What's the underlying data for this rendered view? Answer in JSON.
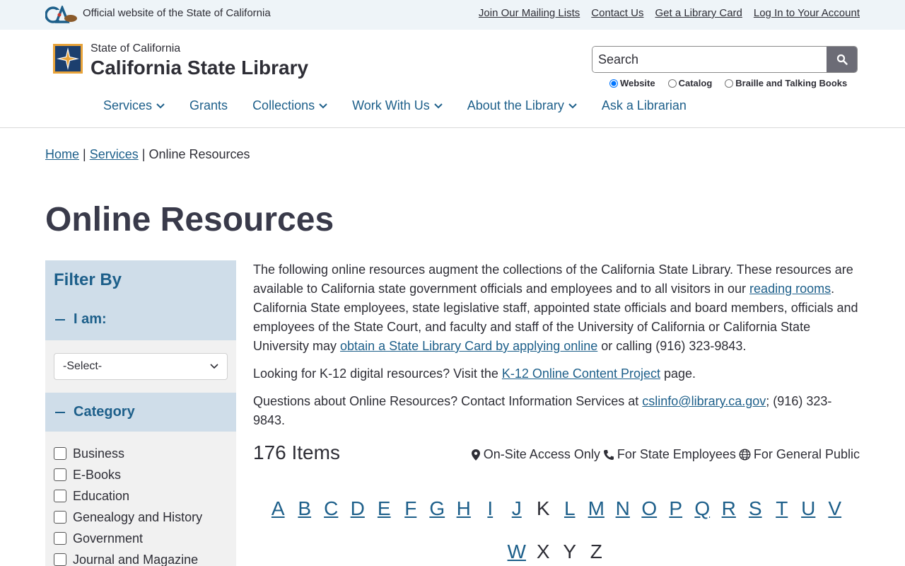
{
  "utility": {
    "official_text": "Official website of the State of California",
    "links": [
      "Join Our Mailing Lists",
      "Contact Us",
      "Get a Library Card",
      "Log In to Your Account"
    ]
  },
  "header": {
    "state_label": "State of California",
    "site_title": "California State Library",
    "search": {
      "placeholder": "Search",
      "scopes": [
        "Website",
        "Catalog",
        "Braille and Talking Books"
      ],
      "selected_scope": "Website"
    },
    "nav": [
      {
        "label": "Services",
        "dropdown": true
      },
      {
        "label": "Grants",
        "dropdown": false
      },
      {
        "label": "Collections",
        "dropdown": true
      },
      {
        "label": "Work With Us",
        "dropdown": true
      },
      {
        "label": "About the Library",
        "dropdown": true
      },
      {
        "label": "Ask a Librarian",
        "dropdown": false
      }
    ]
  },
  "breadcrumb": {
    "home": "Home",
    "services": "Services",
    "current": "Online Resources",
    "sep": "|"
  },
  "page_title": "Online Resources",
  "sidebar": {
    "title": "Filter By",
    "i_am_label": "I am:",
    "select_value": "-Select-",
    "category_label": "Category",
    "categories": [
      "Business",
      "E-Books",
      "Education",
      "Genealogy and History",
      "Government",
      "Journal and Magazine"
    ]
  },
  "content": {
    "p1_a": "The following online resources augment the collections of the California State Library. These resources are available to California state government officials and employees and to all visitors in our ",
    "p1_link1": "reading rooms",
    "p1_b": ". California State employees, state legislative staff, appointed state officials and board members, officials and employees of the State Court, and faculty and staff of the University of California or California State University may ",
    "p1_link2": "obtain a State Library Card by applying online",
    "p1_c": " or calling (916) 323-9843.",
    "p2_a": "Looking for K-12 digital resources? Visit the ",
    "p2_link": "K-12 Online Content Project",
    "p2_b": " page.",
    "p3_a": "Questions about Online Resources? Contact Information Services at ",
    "p3_link": "cslinfo@library.ca.gov",
    "p3_b": "; (916) 323-9843."
  },
  "results": {
    "count": "176 Items",
    "legend": [
      "On-Site Access Only",
      "For State Employees",
      "For General Public"
    ]
  },
  "alphabet": {
    "row1": [
      "A",
      "B",
      "C",
      "D",
      "E",
      "F",
      "G",
      "H",
      "I",
      "J",
      "K",
      "L",
      "M",
      "N",
      "O",
      "P",
      "Q",
      "R",
      "S",
      "T",
      "U",
      "V"
    ],
    "row2": [
      "W",
      "X",
      "Y",
      "Z"
    ],
    "disabled": [
      "K",
      "X",
      "Y",
      "Z"
    ]
  },
  "colors": {
    "link": "#1d5f8a",
    "filter_bg": "#cfdde9",
    "utility_bg": "#eef4f8",
    "search_button": "#6c6c76"
  },
  "icons": {
    "search": "magnifier-icon",
    "on_site": "map-pin-icon",
    "state": "phone-icon",
    "public": "globe-icon"
  }
}
